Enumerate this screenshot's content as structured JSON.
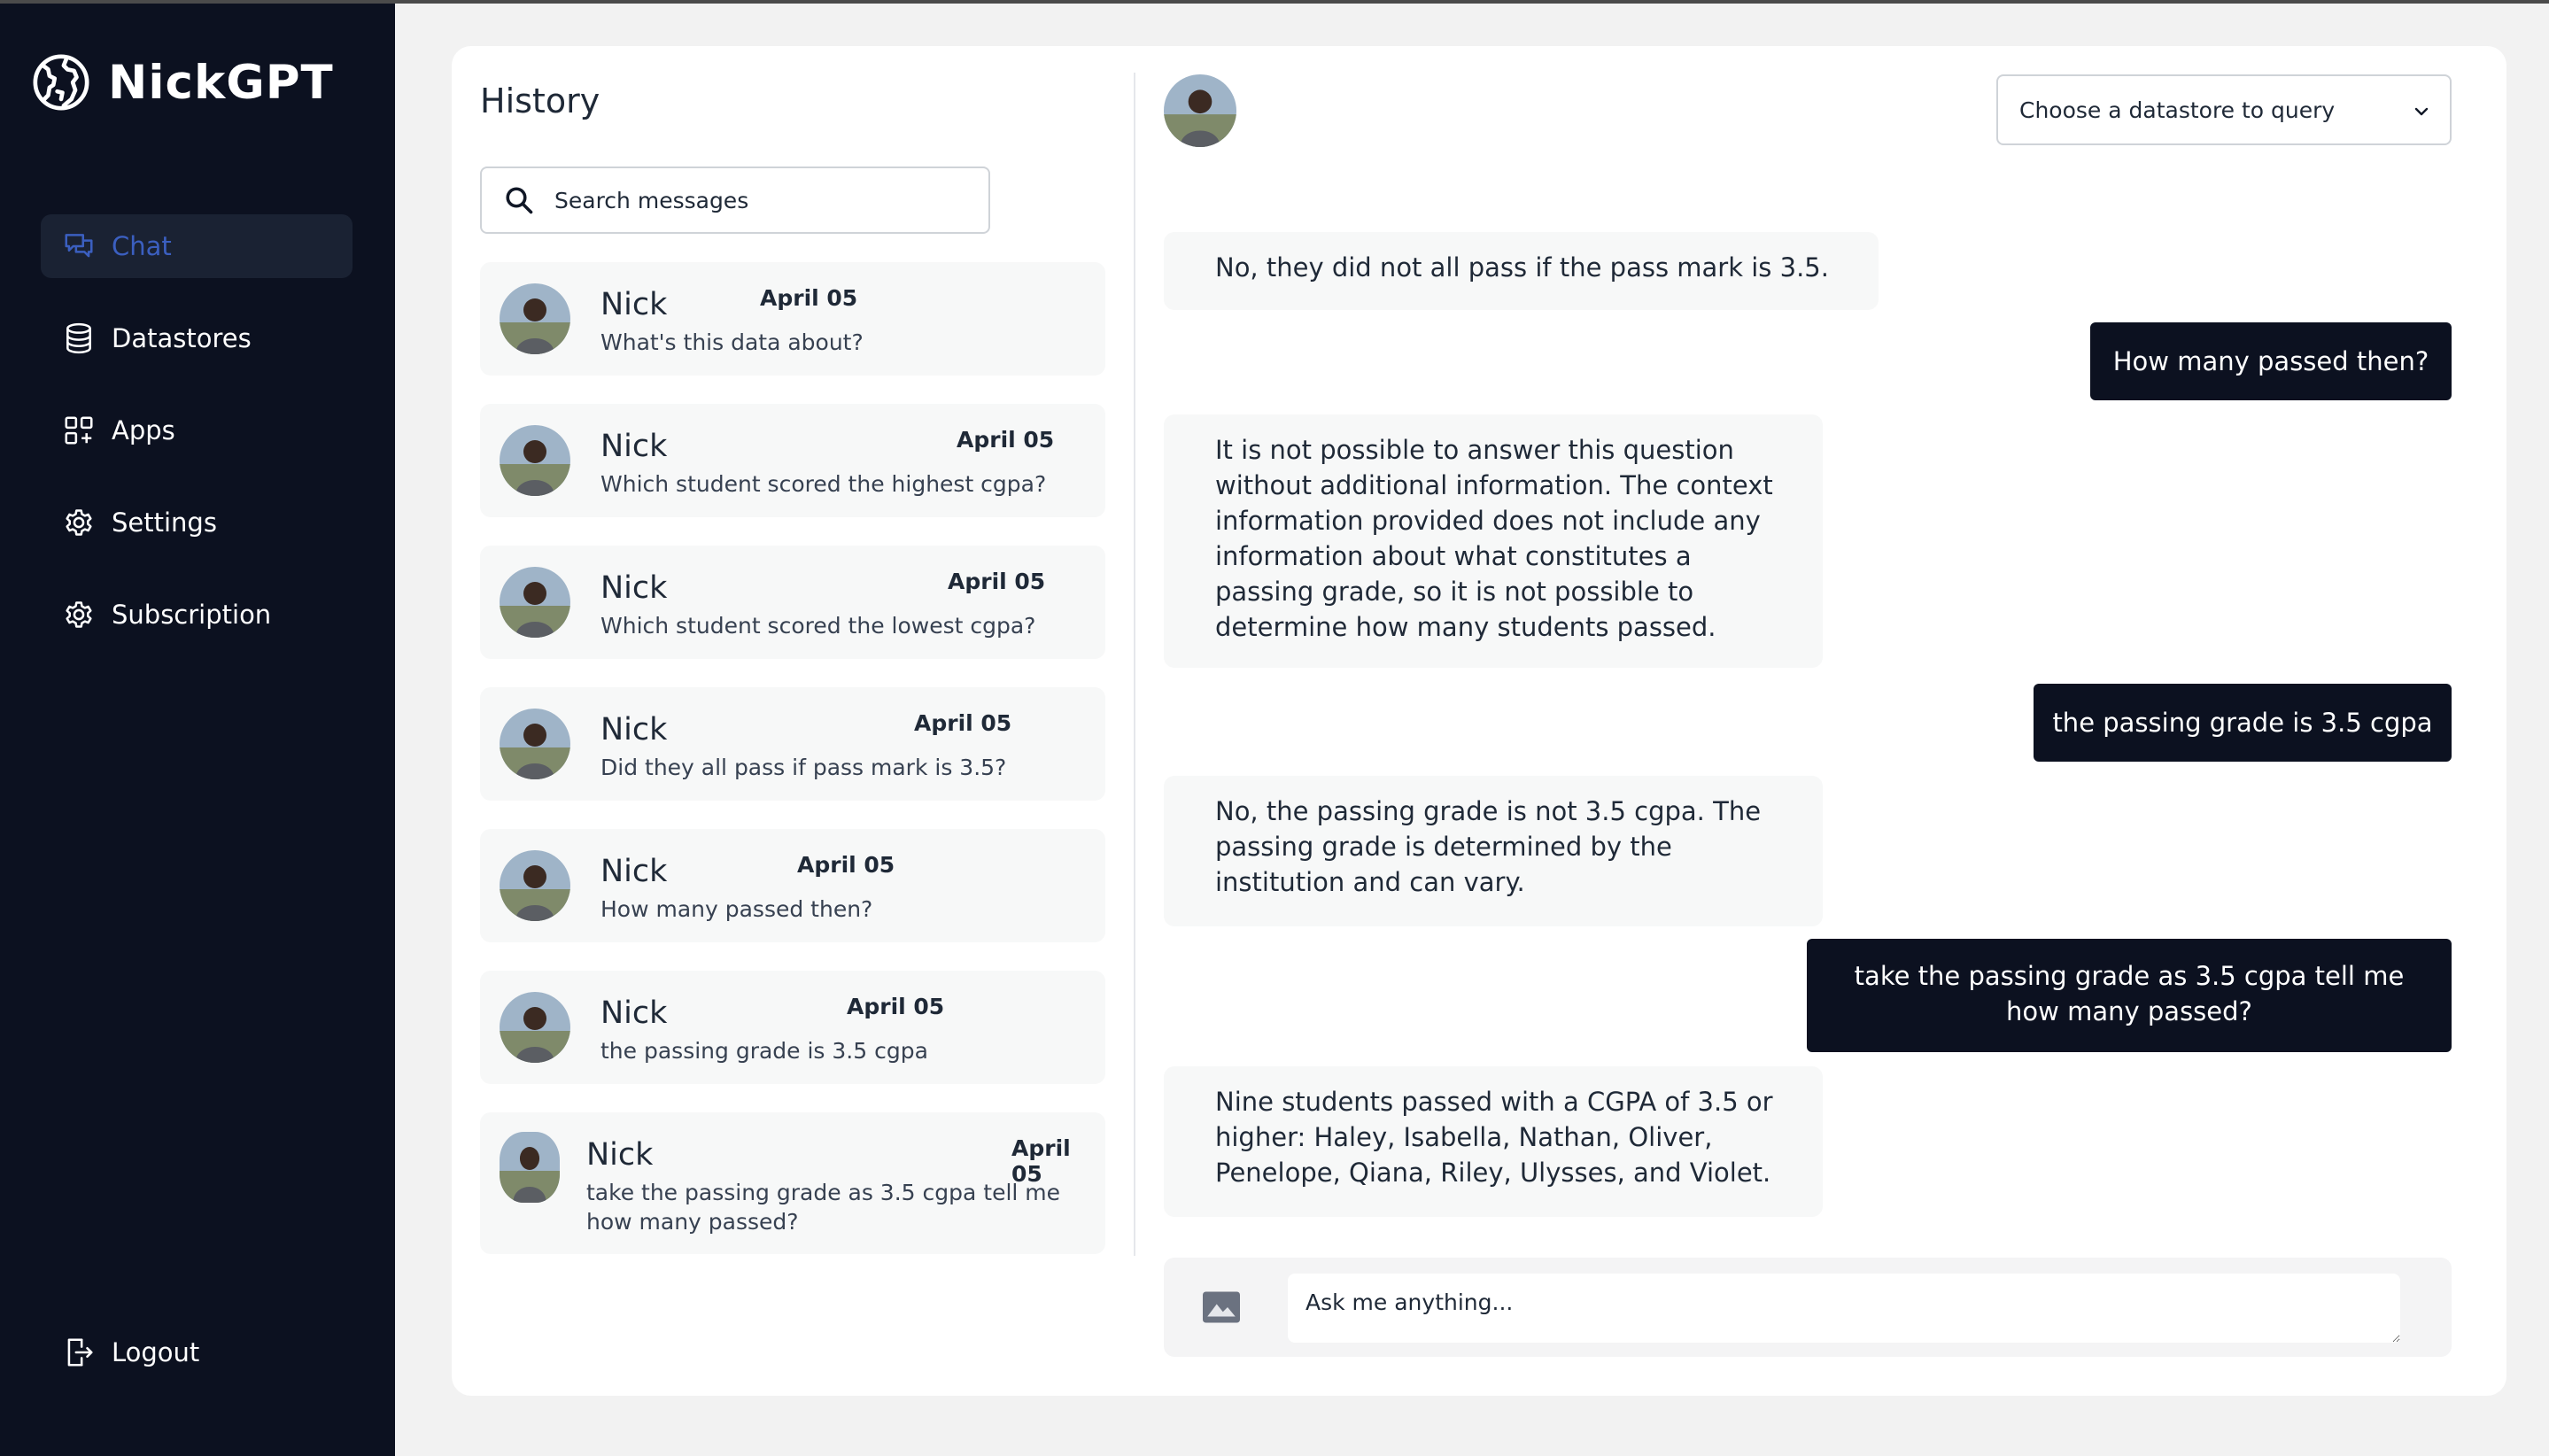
{
  "app": {
    "brand": "NickGPT"
  },
  "sidebar": {
    "items": [
      {
        "label": "Chat",
        "icon": "chat-bubbles-icon",
        "active": true
      },
      {
        "label": "Datastores",
        "icon": "database-icon"
      },
      {
        "label": "Apps",
        "icon": "apps-grid-icon"
      },
      {
        "label": "Settings",
        "icon": "gear-icon"
      },
      {
        "label": "Subscription",
        "icon": "gear-icon"
      }
    ],
    "logout": "Logout"
  },
  "history": {
    "title": "History",
    "search_placeholder": "Search messages",
    "items": [
      {
        "name": "Nick",
        "date": "April 05",
        "message": "What's this data about?"
      },
      {
        "name": "Nick",
        "date": "April 05",
        "message": "Which student scored the highest cgpa?"
      },
      {
        "name": "Nick",
        "date": "April 05",
        "message": "Which student scored the lowest cgpa?"
      },
      {
        "name": "Nick",
        "date": "April 05",
        "message": "Did they all pass if pass mark is 3.5?"
      },
      {
        "name": "Nick",
        "date": "April 05",
        "message": "How many passed then?"
      },
      {
        "name": "Nick",
        "date": "April 05",
        "message": "the passing grade is 3.5 cgpa"
      },
      {
        "name": "Nick",
        "date": "April 05",
        "message": "take the passing grade as 3.5 cgpa tell me how many passed?"
      }
    ]
  },
  "chat": {
    "datastore_select": "Choose a datastore to query",
    "messages": [
      {
        "role": "bot",
        "text": "No, they did not all pass if the pass mark is 3.5."
      },
      {
        "role": "user",
        "text": "How many passed then?"
      },
      {
        "role": "bot",
        "text": "It is not possible to answer this question without additional information. The context information provided does not include any information about what constitutes a passing grade, so it is not possible to determine how many students passed."
      },
      {
        "role": "user",
        "text": "the passing grade is 3.5 cgpa"
      },
      {
        "role": "bot",
        "text": "No, the passing grade is not 3.5 cgpa. The passing grade is determined by the institution and can vary."
      },
      {
        "role": "user",
        "text": "take the passing grade as 3.5 cgpa tell me how many passed?"
      },
      {
        "role": "bot",
        "text": "Nine students passed with a CGPA of 3.5 or higher: Haley, Isabella, Nathan, Oliver, Penelope, Qiana, Riley, Ulysses, and Violet."
      }
    ],
    "input_placeholder": "Ask me anything..."
  },
  "colors": {
    "sidebar_bg": "#0c1120",
    "active_nav": "#3b5fc0",
    "user_bubble": "#0c1120",
    "bot_bubble": "#f7f8f8"
  }
}
